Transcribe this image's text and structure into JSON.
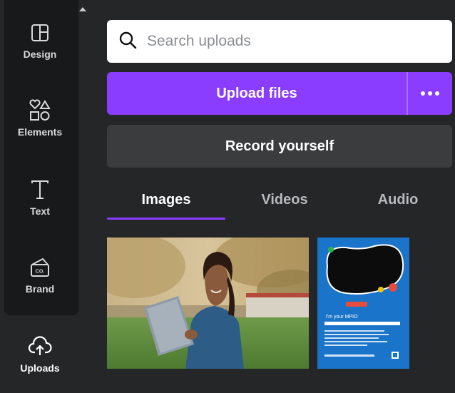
{
  "sidebar": {
    "items": [
      {
        "label": "Design",
        "icon": "layout-icon"
      },
      {
        "label": "Elements",
        "icon": "shapes-icon"
      },
      {
        "label": "Text",
        "icon": "text-icon"
      },
      {
        "label": "Brand",
        "icon": "brand-icon"
      },
      {
        "label": "Uploads",
        "icon": "cloud-upload-icon",
        "active": true
      }
    ]
  },
  "search": {
    "placeholder": "Search uploads",
    "value": ""
  },
  "upload": {
    "label": "Upload files"
  },
  "record": {
    "label": "Record yourself"
  },
  "tabs": [
    {
      "label": "Images",
      "active": true
    },
    {
      "label": "Videos"
    },
    {
      "label": "Audio"
    }
  ],
  "thumbnails": {
    "flyer": {
      "heading": "I'm your MPIO"
    }
  },
  "colors": {
    "accent": "#8b3dff",
    "background": "#252627",
    "sidebar": "#18191b",
    "record_button": "#3b3c3e",
    "flyer_blue": "#1a74c9"
  }
}
